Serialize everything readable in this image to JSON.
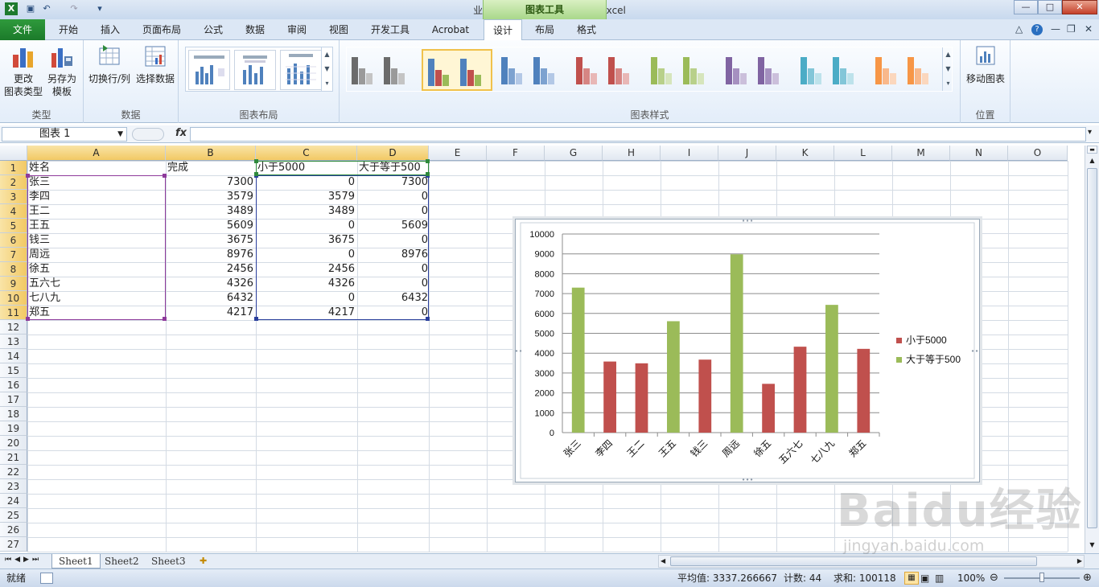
{
  "window": {
    "title": "业绩完成表.xlsx - Microsoft Excel",
    "tool_tab": "图表工具",
    "controls": [
      "—",
      "□",
      "✕"
    ]
  },
  "tabs": {
    "file": "文件",
    "items": [
      "开始",
      "插入",
      "页面布局",
      "公式",
      "数据",
      "审阅",
      "视图",
      "开发工具",
      "Acrobat",
      "设计",
      "布局",
      "格式"
    ],
    "active": "设计"
  },
  "ribbon": {
    "groups": {
      "type": {
        "label": "类型",
        "change_type_line1": "更改",
        "change_type_line2": "图表类型",
        "save_template_line1": "另存为",
        "save_template_line2": "模板"
      },
      "data": {
        "label": "数据",
        "switch_row_col": "切换行/列",
        "select_data": "选择数据"
      },
      "layout": {
        "label": "图表布局"
      },
      "styles": {
        "label": "图表样式"
      },
      "location": {
        "label": "位置",
        "move_chart": "移动图表"
      }
    }
  },
  "formula_bar": {
    "name_box": "图表 1",
    "fx": "fx",
    "value": ""
  },
  "sheet": {
    "columns": [
      "A",
      "B",
      "C",
      "D",
      "E",
      "F",
      "G",
      "H",
      "I",
      "J",
      "K",
      "L",
      "M",
      "N",
      "O"
    ],
    "rows": [
      "1",
      "2",
      "3",
      "4",
      "5",
      "6",
      "7",
      "8",
      "9",
      "10",
      "11",
      "12",
      "13",
      "14",
      "15",
      "16",
      "17",
      "18",
      "19",
      "20",
      "21",
      "22",
      "23",
      "24",
      "25",
      "26",
      "27"
    ],
    "header": [
      "姓名",
      "完成",
      "小于5000",
      "大于等于500"
    ],
    "data": [
      [
        "张三",
        "7300",
        "0",
        "7300"
      ],
      [
        "李四",
        "3579",
        "3579",
        "0"
      ],
      [
        "王二",
        "3489",
        "3489",
        "0"
      ],
      [
        "王五",
        "5609",
        "0",
        "5609"
      ],
      [
        "钱三",
        "3675",
        "3675",
        "0"
      ],
      [
        "周远",
        "8976",
        "0",
        "8976"
      ],
      [
        "徐五",
        "2456",
        "2456",
        "0"
      ],
      [
        "五六七",
        "4326",
        "4326",
        "0"
      ],
      [
        "七八九",
        "6432",
        "0",
        "6432"
      ],
      [
        "郑五",
        "4217",
        "4217",
        "0"
      ]
    ]
  },
  "chart_data": {
    "type": "bar",
    "stacked": true,
    "categories": [
      "张三",
      "李四",
      "王二",
      "王五",
      "钱三",
      "周远",
      "徐五",
      "五六七",
      "七八九",
      "郑五"
    ],
    "series": [
      {
        "name": "小于5000",
        "color": "#c0504d",
        "values": [
          0,
          3579,
          3489,
          0,
          3675,
          0,
          2456,
          4326,
          0,
          4217
        ]
      },
      {
        "name": "大于等于500",
        "color": "#9bbb59",
        "values": [
          7300,
          0,
          0,
          5609,
          0,
          8976,
          0,
          0,
          6432,
          0
        ]
      }
    ],
    "ylim": [
      0,
      10000
    ],
    "yticks": [
      0,
      1000,
      2000,
      3000,
      4000,
      5000,
      6000,
      7000,
      8000,
      9000,
      10000
    ],
    "grid": true,
    "legend": "right"
  },
  "sheet_tabs": [
    "Sheet1",
    "Sheet2",
    "Sheet3"
  ],
  "active_sheet": "Sheet1",
  "status": {
    "ready": "就绪",
    "average": "平均值: 3337.266667",
    "count": "计数: 44",
    "sum": "求和: 100118",
    "zoom": "100%"
  },
  "watermark": {
    "logo": "Baidu经验",
    "url": "jingyan.baidu.com"
  }
}
